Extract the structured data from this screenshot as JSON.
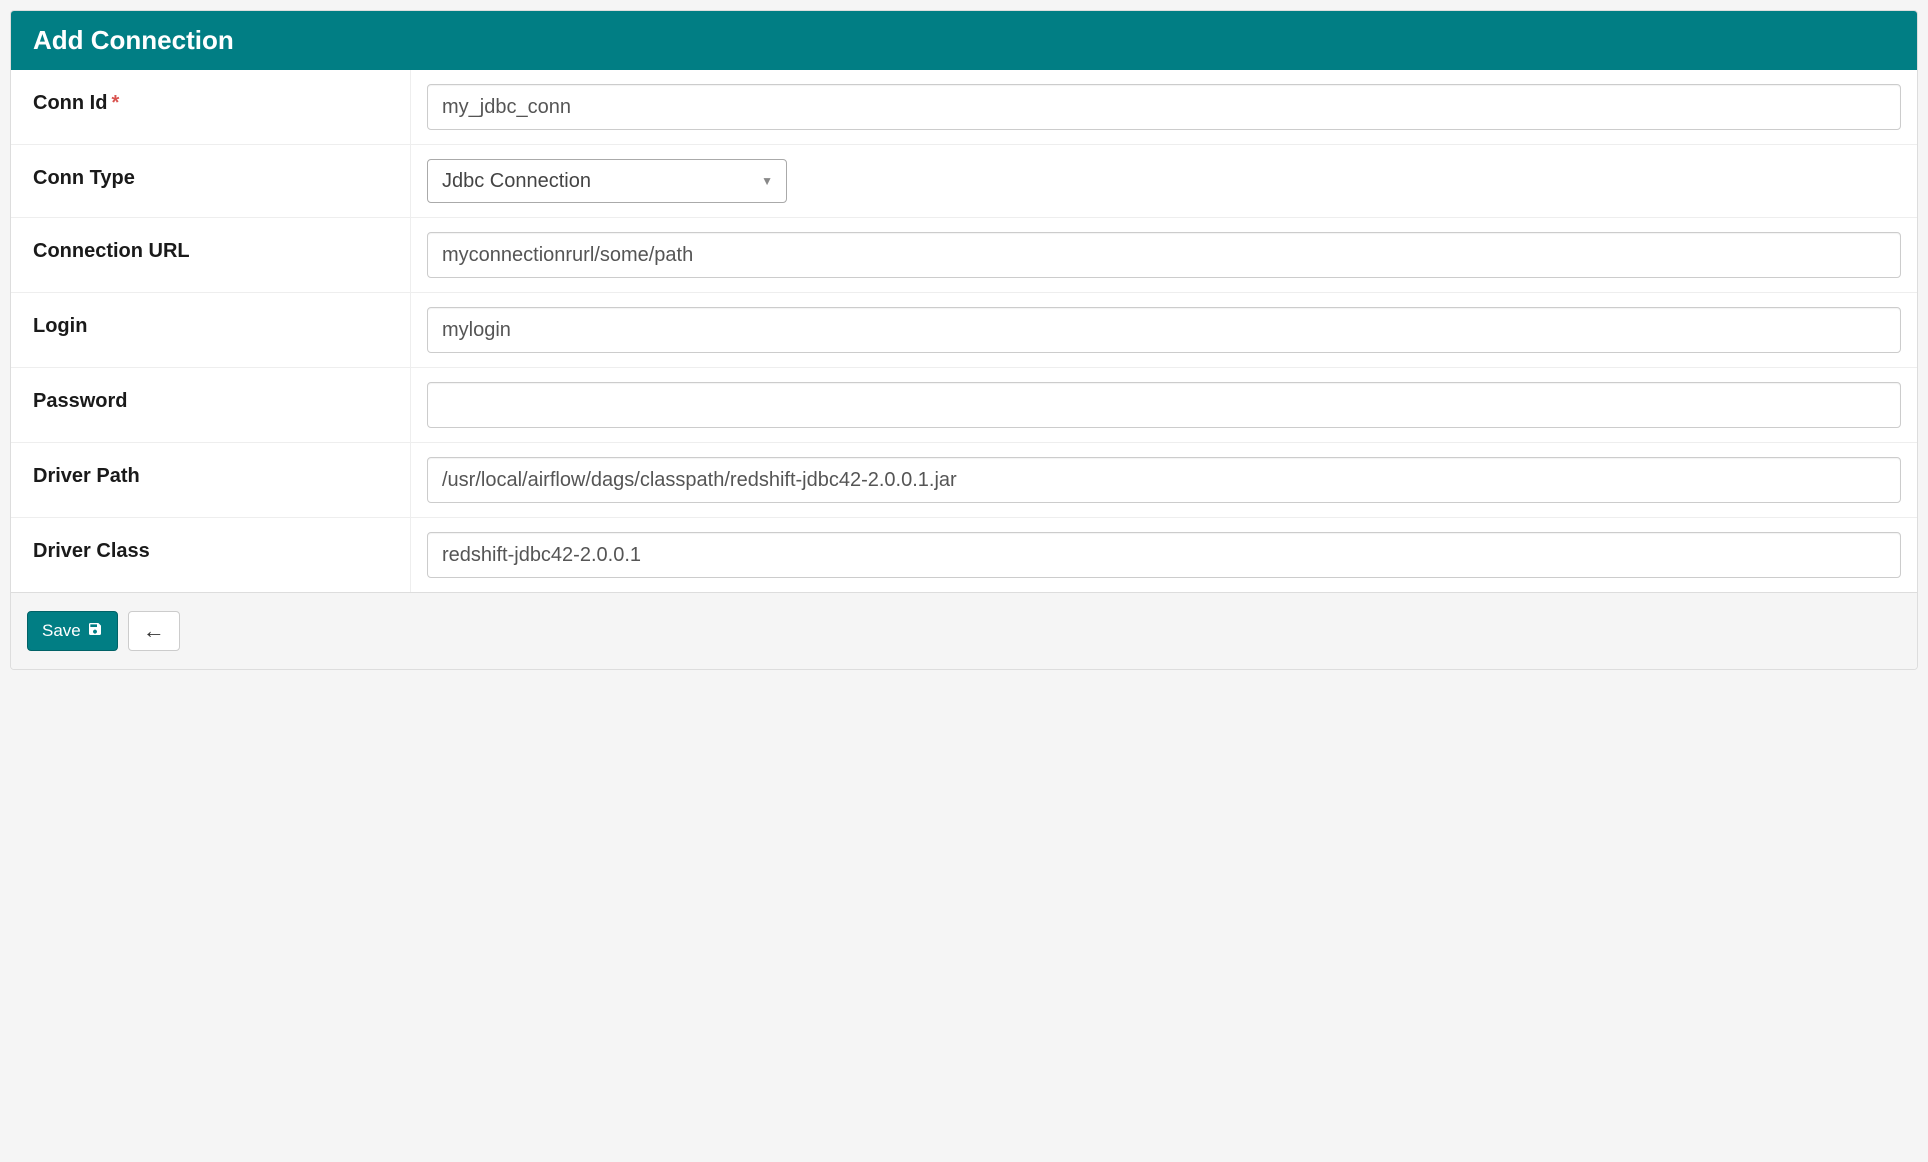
{
  "header": {
    "title": "Add Connection"
  },
  "form": {
    "conn_id": {
      "label": "Conn Id",
      "required": true,
      "value": "my_jdbc_conn"
    },
    "conn_type": {
      "label": "Conn Type",
      "value": "Jdbc Connection"
    },
    "connection_url": {
      "label": "Connection URL",
      "value": "myconnectionrurl/some/path"
    },
    "login": {
      "label": "Login",
      "value": "mylogin"
    },
    "password": {
      "label": "Password",
      "value": ""
    },
    "driver_path": {
      "label": "Driver Path",
      "value": "/usr/local/airflow/dags/classpath/redshift-jdbc42-2.0.0.1.jar"
    },
    "driver_class": {
      "label": "Driver Class",
      "value": "redshift-jdbc42-2.0.0.1"
    }
  },
  "footer": {
    "save_label": "Save"
  }
}
